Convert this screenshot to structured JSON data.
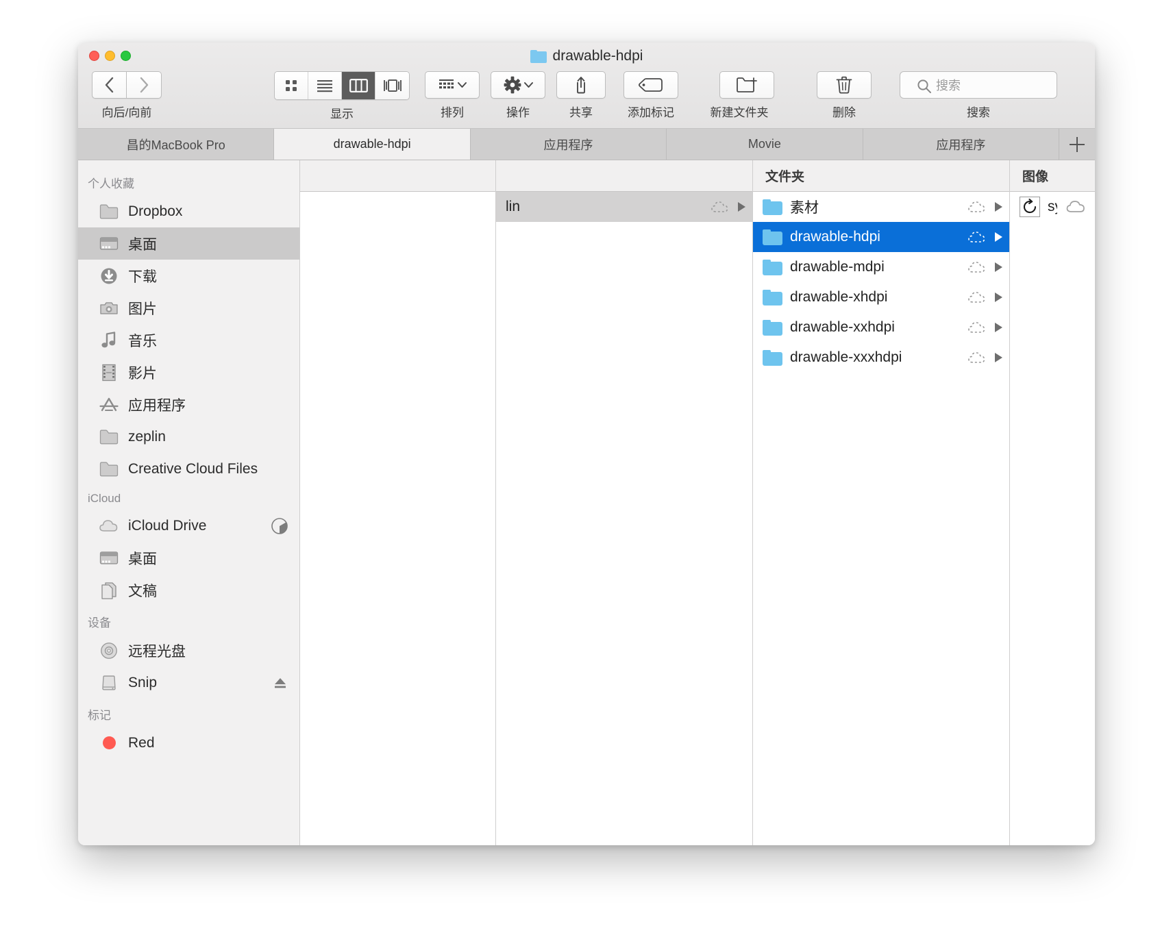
{
  "window": {
    "title": "drawable-hdpi",
    "title_icon": "folder-icon",
    "traffic_lights": [
      "close-button",
      "minimize-button",
      "zoom-button"
    ]
  },
  "toolbar": {
    "nav": {
      "label": "向后/向前",
      "back_icon": "chevron-left-icon",
      "forward_icon": "chevron-right-icon"
    },
    "view": {
      "label": "显示",
      "modes": [
        "icon-view-icon",
        "list-view-icon",
        "column-view-icon",
        "gallery-view-icon"
      ],
      "active_index": 2
    },
    "arrange": {
      "label": "排列",
      "icon": "arrange-icon",
      "chevron": "chevron-down-icon"
    },
    "action": {
      "label": "操作",
      "icon": "gear-icon",
      "chevron": "chevron-down-icon"
    },
    "share": {
      "label": "共享",
      "icon": "share-icon"
    },
    "tag": {
      "label": "添加标记",
      "icon": "tag-icon"
    },
    "newfolder": {
      "label": "新建文件夹",
      "icon": "new-folder-icon"
    },
    "delete": {
      "label": "删除",
      "icon": "trash-icon"
    },
    "search": {
      "label": "搜索",
      "placeholder": "搜索",
      "icon": "search-icon",
      "value": ""
    }
  },
  "tabs": {
    "items": [
      {
        "label": "昌的MacBook Pro",
        "active": false
      },
      {
        "label": "drawable-hdpi",
        "active": true
      },
      {
        "label": "应用程序",
        "active": false
      },
      {
        "label": "Movie",
        "active": false
      },
      {
        "label": "应用程序",
        "active": false
      }
    ],
    "add_label": "+",
    "add_icon": "plus-icon"
  },
  "sidebar": {
    "sections": [
      {
        "title": "个人收藏",
        "items": [
          {
            "label": "Dropbox",
            "icon": "folder-icon",
            "selected": false
          },
          {
            "label": "桌面",
            "icon": "desktop-icon",
            "selected": true
          },
          {
            "label": "下载",
            "icon": "downloads-icon",
            "selected": false
          },
          {
            "label": "图片",
            "icon": "pictures-camera-icon",
            "selected": false
          },
          {
            "label": "音乐",
            "icon": "music-note-icon",
            "selected": false
          },
          {
            "label": "影片",
            "icon": "movies-film-icon",
            "selected": false
          },
          {
            "label": "应用程序",
            "icon": "applications-icon",
            "selected": false
          },
          {
            "label": "zeplin",
            "icon": "folder-icon",
            "selected": false
          },
          {
            "label": "Creative Cloud Files",
            "icon": "folder-icon",
            "selected": false
          }
        ]
      },
      {
        "title": "iCloud",
        "items": [
          {
            "label": "iCloud Drive",
            "icon": "cloud-icon",
            "selected": false,
            "accessory": "sync-progress-pie"
          },
          {
            "label": "桌面",
            "icon": "desktop-icon",
            "selected": false
          },
          {
            "label": "文稿",
            "icon": "documents-icon",
            "selected": false
          }
        ]
      },
      {
        "title": "设备",
        "items": [
          {
            "label": "远程光盘",
            "icon": "disc-icon",
            "selected": false
          },
          {
            "label": "Snip",
            "icon": "drive-icon",
            "selected": false,
            "accessory": "eject-icon"
          }
        ]
      },
      {
        "title": "标记",
        "items": [
          {
            "label": "Red",
            "icon": "tag-dot-icon",
            "selected": false,
            "color": "#ff5a52"
          }
        ]
      }
    ]
  },
  "columns": [
    {
      "header": "",
      "rows": []
    },
    {
      "header": "",
      "rows": [
        {
          "name": "lin",
          "icon": "",
          "state": "gray-selected",
          "cloud": "dashed-cloud-icon",
          "disclosure": "disclosure-triangle-icon"
        }
      ]
    },
    {
      "header": "文件夹",
      "rows": [
        {
          "name": "素材",
          "icon": "folder-icon",
          "state": "normal",
          "cloud": "dashed-cloud-icon",
          "disclosure": "disclosure-triangle-icon"
        },
        {
          "name": "drawable-hdpi",
          "icon": "folder-icon",
          "state": "selected",
          "cloud": "dashed-cloud-icon",
          "disclosure": "disclosure-triangle-icon"
        },
        {
          "name": "drawable-mdpi",
          "icon": "folder-icon",
          "state": "normal",
          "cloud": "dashed-cloud-icon",
          "disclosure": "disclosure-triangle-icon"
        },
        {
          "name": "drawable-xhdpi",
          "icon": "folder-icon",
          "state": "normal",
          "cloud": "dashed-cloud-icon",
          "disclosure": "disclosure-triangle-icon"
        },
        {
          "name": "drawable-xxhdpi",
          "icon": "folder-icon",
          "state": "normal",
          "cloud": "dashed-cloud-icon",
          "disclosure": "disclosure-triangle-icon"
        },
        {
          "name": "drawable-xxxhdpi",
          "icon": "folder-icon",
          "state": "normal",
          "cloud": "dashed-cloud-icon",
          "disclosure": "disclosure-triangle-icon"
        }
      ]
    },
    {
      "header": "图像",
      "rows": [
        {
          "name": "sync.png",
          "icon": "sync-png-thumbnail",
          "state": "normal",
          "cloud": "cloud-icon",
          "disclosure": ""
        }
      ]
    }
  ],
  "colors": {
    "selection_blue": "#0a6fd8",
    "folder_blue": "#6ec4ee",
    "sidebar_bg": "#f2f1f1",
    "titlebar_bg": "#e8e7e7",
    "tab_inactive": "#cfcece",
    "tab_active": "#f1f0f0"
  }
}
